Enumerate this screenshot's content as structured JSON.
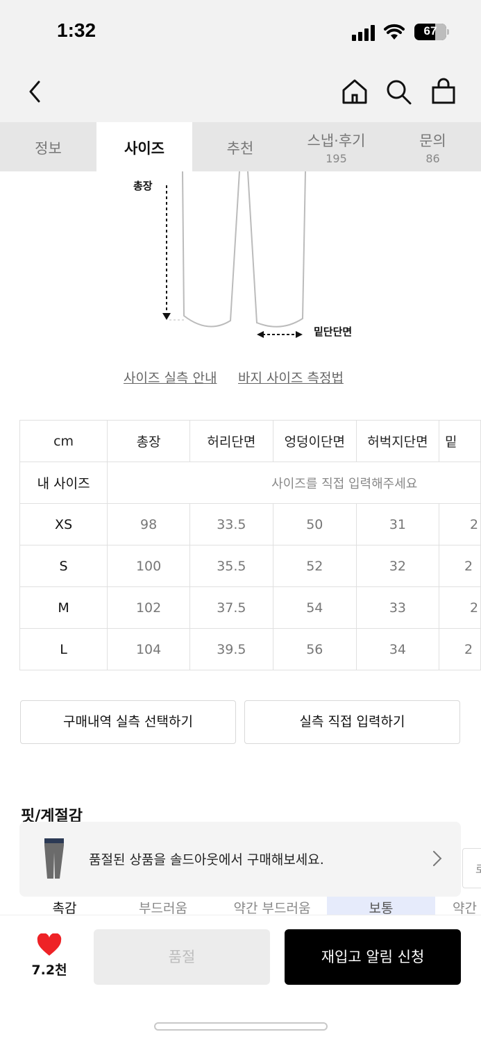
{
  "status_bar": {
    "time": "1:32",
    "battery": "67"
  },
  "nav": {
    "icons": [
      "back-icon",
      "home-icon",
      "search-icon",
      "shopping-bag-icon"
    ]
  },
  "tabs": [
    {
      "label": "정보",
      "count": ""
    },
    {
      "label": "사이즈",
      "count": "",
      "active": true
    },
    {
      "label": "추천",
      "count": ""
    },
    {
      "label": "스냅·후기",
      "count": "195"
    },
    {
      "label": "문의",
      "count": "86"
    }
  ],
  "diagram": {
    "length_label": "총장",
    "hem_label": "밑단단면"
  },
  "guide_links": {
    "size_guide": "사이즈 실측 안내",
    "pants_measure": "바지 사이즈 측정법"
  },
  "size_table": {
    "headers": [
      "cm",
      "총장",
      "허리단면",
      "엉덩이단면",
      "허벅지단면",
      "밑"
    ],
    "my_size": {
      "label": "내 사이즈",
      "placeholder": "사이즈를 직접 입력해주세요"
    },
    "rows": [
      {
        "size": "XS",
        "values": [
          "98",
          "33.5",
          "50",
          "31",
          "2"
        ]
      },
      {
        "size": "S",
        "values": [
          "100",
          "35.5",
          "52",
          "32",
          "2"
        ]
      },
      {
        "size": "M",
        "values": [
          "102",
          "37.5",
          "54",
          "33",
          "2"
        ]
      },
      {
        "size": "L",
        "values": [
          "104",
          "39.5",
          "56",
          "34",
          "2"
        ]
      }
    ]
  },
  "actions": {
    "history_select": "구매내역 실측 선택하기",
    "direct_input": "실측 직접 입력하기"
  },
  "fit": {
    "title": "핏/계절감",
    "row": {
      "label": "촉감",
      "options": [
        "부드러움",
        "약간 부드러움",
        "보통",
        "약간"
      ],
      "selected": "보통"
    }
  },
  "banner": {
    "text": "품절된 상품을 솔드아웃에서 구매해보세요.",
    "edge_text": "로"
  },
  "bottom_bar": {
    "like_count": "7.2천",
    "soldout_label": "품절",
    "restock_label": "재입고 알림 신청"
  },
  "colors": {
    "heart": "#ee2226",
    "primary_button": "#000000",
    "disabled_button": "#ececec",
    "selected_fit": "#e6ebfb"
  }
}
